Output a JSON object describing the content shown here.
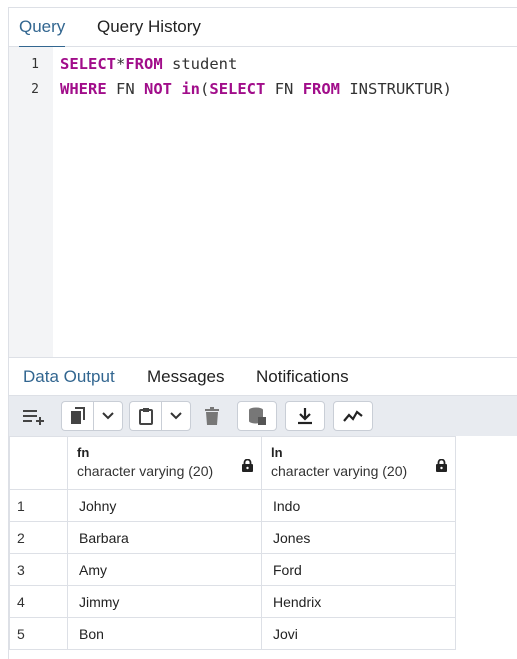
{
  "top_tabs": [
    {
      "label": "Query",
      "active": true
    },
    {
      "label": "Query History",
      "active": false
    }
  ],
  "editor": {
    "lines": [
      {
        "number": "1"
      },
      {
        "number": "2"
      }
    ],
    "line1": {
      "kw1": "SELECT",
      "op": "*",
      "kw2": "FROM",
      "rest": " student"
    },
    "line2": {
      "kw1": "WHERE",
      "t1": " FN ",
      "kw2": "NOT",
      "t2": " ",
      "kw3": "in",
      "t3": "(",
      "kw4": "SELECT",
      "t4": " FN ",
      "kw5": "FROM",
      "t5": " INSTRUKTUR)"
    }
  },
  "bottom_tabs": [
    {
      "label": "Data Output",
      "active": true
    },
    {
      "label": "Messages",
      "active": false
    },
    {
      "label": "Notifications",
      "active": false
    }
  ],
  "toolbar": {
    "icons": [
      "add-row-icon",
      "copy-icon",
      "chevron-down-icon",
      "paste-icon",
      "chevron-down-icon",
      "delete-icon",
      "save-data-icon",
      "download-icon",
      "graph-icon"
    ]
  },
  "table": {
    "columns": [
      {
        "name": "fn",
        "type": "character varying (20)"
      },
      {
        "name": "ln",
        "type": "character varying (20)"
      }
    ],
    "rows": [
      {
        "n": "1",
        "fn": "Johny",
        "ln": "Indo"
      },
      {
        "n": "2",
        "fn": "Barbara",
        "ln": "Jones"
      },
      {
        "n": "3",
        "fn": "Amy",
        "ln": "Ford"
      },
      {
        "n": "4",
        "fn": "Jimmy",
        "ln": "Hendrix"
      },
      {
        "n": "5",
        "fn": "Bon",
        "ln": "Jovi"
      }
    ]
  },
  "colors": {
    "accent": "#326690",
    "keyword": "#a10d8a"
  }
}
